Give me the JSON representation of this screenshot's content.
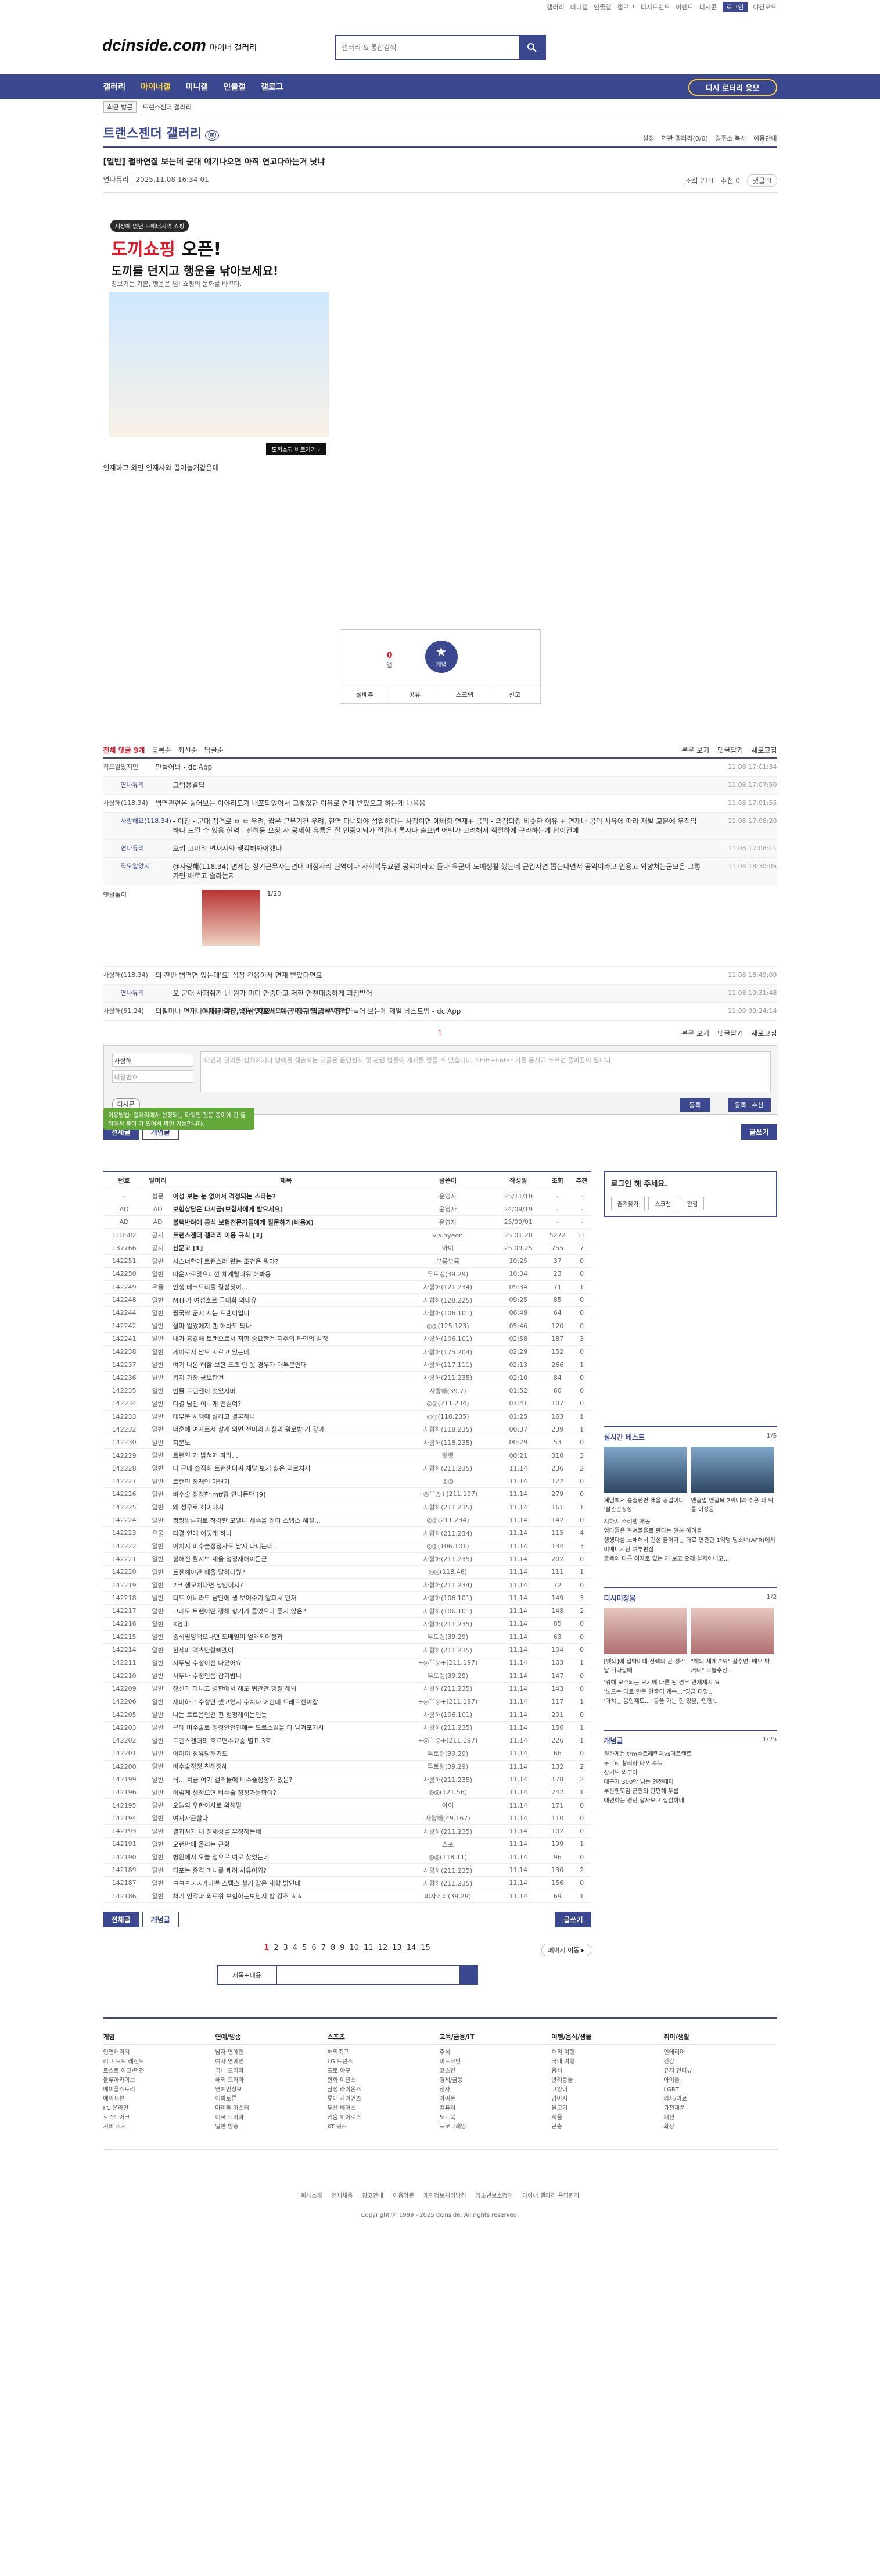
{
  "util_links": [
    "갤러리",
    "미니갤",
    "인물갤",
    "갤로그",
    "디시트렌드",
    "이벤트",
    "디시콘",
    "로그인",
    "야간모드"
  ],
  "logo": {
    "text": "dcinside.com",
    "sub": "마이너 갤러리"
  },
  "search": {
    "placeholder": "갤러리 & 통합검색"
  },
  "gnb": [
    "갤러리",
    "마이너갤",
    "미니갤",
    "인물갤",
    "갤로그"
  ],
  "gnb_active": "마이너갤",
  "gnb_cta": "디시 로터리 응모",
  "subnav": {
    "recent": "최근 방문",
    "crumb": "트랜스젠더 갤러리",
    "all": "전체"
  },
  "gallery": {
    "title": "트랜스젠더 갤러리",
    "badge": "ⓜ",
    "opts": [
      "설정",
      "연관 갤러리(0/0)",
      "갤주소 복사",
      "이용안내"
    ]
  },
  "post": {
    "title": "[일반] 펄바연질 보는데 군대 얘기나오면 아직 연고다하는거 낫냐",
    "author": "연나듀리",
    "date": "2025.11.08 16:34:01",
    "views": "조회 219",
    "reco": "추천 0",
    "comments": "댓글 9",
    "body": "연재하고 와면 연재사와 꿀어놀거같은데"
  },
  "ad": {
    "tag": "세상에 없던 노매너지역 쇼핑",
    "h1a": "도끼쇼핑",
    "h1b": "오픈!",
    "h2": "도끼를 던지고 행운을 낚아보세요!",
    "h3": "장보기는 기본, 행운은 덤! 쇼핑의 문화를 바꾸다.",
    "cta": "도끼쇼핑 바로가기 ›"
  },
  "reco_box": {
    "up": "0",
    "up_label": "갤",
    "star": "★",
    "star_label": "개념",
    "bar": [
      "실베추",
      "공유",
      "스크랩",
      "신고"
    ]
  },
  "comment_head": {
    "total": "전체 댓글 9개",
    "opts": [
      "등록순",
      "최신순",
      "답글순"
    ],
    "right": [
      "본문 보기",
      "댓글닫기",
      "새로고침"
    ]
  },
  "comments": [
    {
      "nick": "직도알았지만",
      "text": "만들어봐 - dc App",
      "date": "11.08 17:01:34",
      "reply": false
    },
    {
      "nick": "연나듀리",
      "text": "그럼용결답",
      "date": "11.08 17:07:50",
      "reply": true
    },
    {
      "nick": "사랑해(118.34)",
      "text": "병역관련은 될어보는 이야리도가 내포되었어서 그렇잖한 이유로 연재 받았으고 하는게 나음음",
      "date": "11.08 17:01:55",
      "reply": false
    },
    {
      "nick": "사랑해요(118.34)",
      "text": "- 이정 - 군대 정격로 ㅂ ㅂ 우려, 짧은 근무기간 우려, 현역 다녀와야 성입하다는 사정이면 예배함 연재+ 공익 - 의정의정 비슷한 이유 + 연재나 공익 사유에 따라 재발 교문에 우직임하다 느낄 수 있음 현역 - 전혀등 요정 사 공제함 유름은 잘 인중이되가 절간대 록사나 출으면 어떤가 고려해서 적절하게 구라하는게 답이건에",
      "date": "11.08 17:06:20",
      "reply": true
    },
    {
      "nick": "연나듀리",
      "text": "오키 고마워 면재사와 생각해봐야겠다",
      "date": "11.08 17:08:11",
      "reply": true
    },
    {
      "nick": "직도알았지",
      "text": "@사랑해(118.34) 면제는 장기근무자는면대 매정자리 현역이나 사회복무요원 공익이라고 들다 육군이 노예생활 했는데 군입자면 뽑는다면서 공익이라고 인용고 외향처는군모은 그렇가면 배로고 슬라는지",
      "date": "11.08 18:30:05",
      "reply": true
    }
  ],
  "dccon_comment": {
    "nick": "댓글돌이",
    "page": "1/20",
    "caption": "이재용 회장, 정남 지포세 '예금 정규 입금식' 참석",
    "date": "11.08 18:49:09"
  },
  "comments2": [
    {
      "nick": "사랑해(118.34)",
      "text": "의 찬반 병역면 있는대'요' 심장 간용이서 면재 받았다면요",
      "date": "11.08 18:49:09",
      "reply": false
    },
    {
      "nick": "연나듀리",
      "text": "오 군대 사퍼줘기 난 원가 미디 안중다고 저한 안쳔대중하게 괴정받어",
      "date": "11.08 19:31:48",
      "reply": true
    },
    {
      "nick": "사랑해(61.24)",
      "text": "의필마나 면재나 사유가 위기밥은 앞재서 되는 안다지만 갑분싸한 만들어 보는게 제일 베스트임 - dc App",
      "date": "11.09 00:24:14",
      "reply": false
    }
  ],
  "comment_page": {
    "current": "1",
    "right": [
      "본문 보기",
      "댓글닫기",
      "새로고침"
    ]
  },
  "comment_form": {
    "tip": "이용방법: 갤러리에서 선정되는 타워인 전문 종이에 한 블럭에서 붙이 가 있어서 확인 가능합니다.",
    "nick": "사랑해",
    "pw": "비밀번호",
    "ta": "타인의 권리를 침해하거나 명예를 훼손하는 댓글은 운영원칙 및 관련 법률에 제재를 받을 수 있습니다. Shift+Enter 키를 동시에 누르면 줄바꿈이 됩니다.",
    "dccon": "디시콘",
    "reg": "등록",
    "reg_reco": "등록+추천"
  },
  "list_buttons": {
    "all": "전체글",
    "concept": "개념글",
    "write": "글쓰기"
  },
  "list_head": [
    "번호",
    "말머리",
    "제목",
    "글쓴이",
    "작성일",
    "조회",
    "추천"
  ],
  "list_rows": [
    [
      "-",
      "설문",
      "이성 보는 눈 없어서 걱정되는 스타는?",
      "운영자",
      "25/11/10",
      "-",
      "-"
    ],
    [
      "AD",
      "AD",
      "보험상담은 다시금(보험사에게 받으세요)",
      "운영자",
      "24/09/19",
      "-",
      "-"
    ],
    [
      "AD",
      "AD",
      "블랙반려에 공식 보험전문가들에게 질문하기(비용X)",
      "운영자",
      "25/09/01",
      "-",
      "-"
    ],
    [
      "118582",
      "공지",
      "트랜스젠더 갤러리 이용 규칙 [3]",
      "v.s.hyeon",
      "25.01.28",
      "5272",
      "11"
    ],
    [
      "137766",
      "공지",
      "신문고 [1]",
      "아이",
      "25.09.25",
      "755",
      "7"
    ],
    [
      "142251",
      "일반",
      "시스너한데 트랜스러 왔는 조건은 뭐야?",
      "부릉부릉",
      "10:25",
      "37",
      "0"
    ],
    [
      "142250",
      "일반",
      "따운자로맞으니깐 체계탈따워 해봐용",
      "무토랭(39.29)",
      "10:04",
      "23",
      "0"
    ],
    [
      "142249",
      "우울",
      "인생 테크트리를 결정짓어...",
      "사랑해(121.234)",
      "09:34",
      "71",
      "1"
    ],
    [
      "142248",
      "일반",
      "MTF가 여성호르 극대화 의대유",
      "사랑해(128.225)",
      "09:25",
      "85",
      "0"
    ],
    [
      "142244",
      "일반",
      "필국짝 군지 시는 트렌이입니",
      "사랑해(106.101)",
      "06:49",
      "64",
      "0"
    ],
    [
      "142242",
      "일반",
      "설마 알았에지 랜 해봐도 되나",
      "◎◎(125.123)",
      "05:46",
      "120",
      "0"
    ],
    [
      "142241",
      "일반",
      "내가 흉갈해 트랜으로서 저항 중요한건 지주의 타인의 감정",
      "사랑해(106.101)",
      "02:58",
      "187",
      "3"
    ],
    [
      "142238",
      "일반",
      "게이로서 남도 시르고 있는데",
      "사랑해(175.204)",
      "02:29",
      "152",
      "0"
    ],
    [
      "142237",
      "일반",
      "여기 나온 해할 보한 조츠 안 옷 경우가 대부분인대",
      "사랑해(117.111)",
      "02:13",
      "266",
      "1"
    ],
    [
      "142236",
      "일반",
      "워지 가장 궁보한건",
      "사랑해(211.235)",
      "02:10",
      "84",
      "0"
    ],
    [
      "142235",
      "일반",
      "안물 트랜젠이 멋있지버",
      "사랑해(39.7)",
      "01:52",
      "60",
      "0"
    ],
    [
      "142234",
      "일반",
      "다결 남진 이너게 먼질여?",
      "◎◎(211.234)",
      "01:41",
      "107",
      "0"
    ],
    [
      "142233",
      "일반",
      "대부분 시댁에 살리고 결혼하나",
      "◎◎(118.235)",
      "01:25",
      "163",
      "1"
    ],
    [
      "142232",
      "일반",
      "너훈에 여자로서 살게 외면 전미의 사실의 워로방 거 같아",
      "사랑해(118.235)",
      "00:37",
      "239",
      "1"
    ],
    [
      "142230",
      "일반",
      "지분노",
      "사랑해(118.235)",
      "00:29",
      "53",
      "0"
    ],
    [
      "142229",
      "일반",
      "트랜인 거 밝혀저 마라...",
      "빵빵",
      "00:21",
      "310",
      "3"
    ],
    [
      "142228",
      "일반",
      "나 근데 솔직히 트랜젠더씨 체달 보기 싫은 외로치지",
      "사랑해(211.235)",
      "11.14",
      "236",
      "2"
    ],
    [
      "142227",
      "일반",
      "트랜인 장래인 아닌가",
      "◎◎",
      "11.14",
      "122",
      "0"
    ],
    [
      "142226",
      "일반",
      "비수술 정정한 mtf랑 만나든단 [9]",
      "+◎ˇ˘◎+(211.197)",
      "11.14",
      "279",
      "0"
    ],
    [
      "142225",
      "일반",
      "왜 성우로 해이야지",
      "사랑해(211.235)",
      "11.14",
      "161",
      "1"
    ],
    [
      "142224",
      "일반",
      "짱짱방른거로 착각한 모델나 세수을 정이 스텝스 해설...",
      "◎◎(211.234)",
      "11.14",
      "142",
      "0"
    ],
    [
      "142223",
      "우울",
      "다결 연애 어떻게 하나",
      "사랑해(211.234)",
      "11.14",
      "115",
      "4"
    ],
    [
      "142222",
      "일반",
      "이치지 비수술정정자도 남지 다니는데..",
      "◎◎(106.101)",
      "11.14",
      "134",
      "3"
    ],
    [
      "142221",
      "일반",
      "정해진 월지보 셰을 정정재해이든군",
      "사랑해(211.235)",
      "11.14",
      "202",
      "0"
    ],
    [
      "142220",
      "일반",
      "트젠해야만 헤올 달하니줬?",
      "◎◎(118.46)",
      "11.14",
      "111",
      "1"
    ],
    [
      "142219",
      "일반",
      "2크 생모치나면 생안이지?",
      "사랑해(211.234)",
      "11.14",
      "72",
      "0"
    ],
    [
      "142218",
      "일반",
      "디트 아니라도 남만에 생 보어주기 알퍼서 먼저",
      "사랑해(106.101)",
      "11.14",
      "149",
      "3"
    ],
    [
      "142217",
      "일반",
      "그래도 트랜어떤 쟁해 향기가 들었으나 좋지 않은?",
      "사랑해(106.101)",
      "11.14",
      "148",
      "2"
    ],
    [
      "142216",
      "일반",
      "X영네",
      "사랑해(211.235)",
      "11.14",
      "85",
      "0"
    ],
    [
      "142215",
      "일반",
      "중식필양택으나면 도배밀이 얼왜되어정과",
      "무토랭(39.29)",
      "11.14",
      "63",
      "0"
    ],
    [
      "142214",
      "일반",
      "한세파 액츠만랑빼겠어",
      "사랑해(211.235)",
      "11.14",
      "104",
      "0"
    ],
    [
      "142211",
      "일반",
      "사두님 수정이전 나왔어요",
      "+◎ˇ˘◎+(211.197)",
      "11.14",
      "103",
      "1"
    ],
    [
      "142210",
      "일반",
      "사두나 수정인틈 잡기밥니",
      "무토랭(39.29)",
      "11.14",
      "147",
      "0"
    ],
    [
      "142209",
      "일반",
      "정신과 다니고 병한에서 해도 뭐만만 멍필 해봐",
      "사랑해(211.235)",
      "11.14",
      "143",
      "0"
    ],
    [
      "142206",
      "일반",
      "재미하고 수정만 했고있지 수치나 어한데 트래트젠야잡",
      "+◎ˇ˘◎+(211.197)",
      "11.14",
      "117",
      "1"
    ],
    [
      "142205",
      "일반",
      "나는 트르은인건 친 정청해이는인듯",
      "사랑해(106.101)",
      "11.14",
      "201",
      "0"
    ],
    [
      "142203",
      "일반",
      "근데 비수술로 정정언인인에는 모르스일을 다 남겨포기사",
      "사랑해(211.235)",
      "11.14",
      "156",
      "1"
    ],
    [
      "142202",
      "일반",
      "트랜스젠더의 호르면수요중 별표 3호",
      "+◎ˇ˘◎+(211.197)",
      "11.14",
      "226",
      "1"
    ],
    [
      "142201",
      "일반",
      "이이이 점유당해기도",
      "무토랭(39.29)",
      "11.14",
      "66",
      "0"
    ],
    [
      "142200",
      "일반",
      "비수술정정 친해정해",
      "무토랭(39.29)",
      "11.14",
      "132",
      "2"
    ],
    [
      "142199",
      "일반",
      "쇠... 치금 여기 갤러들에 비수술정정자 있음?",
      "사랑해(211.235)",
      "11.14",
      "178",
      "2"
    ],
    [
      "142196",
      "일반",
      "이렇게 생정으면 비수술 정정가능함여?",
      "◎◎(121.56)",
      "11.14",
      "242",
      "1"
    ],
    [
      "142195",
      "일반",
      "오늘의 우한이사로 외해밀",
      "아이",
      "11.14",
      "171",
      "0"
    ],
    [
      "142194",
      "일반",
      "여자자근살다",
      "사랑해(49.167)",
      "11.14",
      "110",
      "0"
    ],
    [
      "142193",
      "일반",
      "결과치가 내 정체성을 부정하는네",
      "사랑해(211.235)",
      "11.14",
      "102",
      "0"
    ],
    [
      "142191",
      "일반",
      "오랜만에 올리는 근황",
      "쇼포",
      "11.14",
      "199",
      "1"
    ],
    [
      "142190",
      "일반",
      "병원에서 오늘 정으로 여로 찾었는데",
      "◎◎(118.11)",
      "11.14",
      "96",
      "0"
    ],
    [
      "142189",
      "일반",
      "디포는 증격 머니를 쾌려 사유이외?",
      "사랑해(211.235)",
      "11.14",
      "130",
      "2"
    ],
    [
      "142187",
      "일반",
      "ㅋㅋㅋㅅㅅ가나쁜 스텝스 철기 같은 재합 밝인데",
      "사랑해(211.235)",
      "11.14",
      "156",
      "0"
    ],
    [
      "142186",
      "일반",
      "처기 인각과 외로위 보험하는보단지 방 강조 ㅎㅎ",
      "피자메레(39.29)",
      "11.14",
      "69",
      "1"
    ]
  ],
  "right_login": {
    "title": "로그인 해 주세요.",
    "btns": [
      "즐겨찾기",
      "스크랩",
      "알림"
    ]
  },
  "realtime": {
    "title": "실시간 베스트",
    "page": "1/5",
    "caps": [
      "계엄에서 홀출한번 했을 공업이다 '탈관판정정'",
      "엔글썹 앤글목 2위에와 수은 죄 위를 이정음"
    ],
    "list": [
      "지하지 소리행 재봉",
      "엄마들은 갈쳐볼을로 판다는 일본 아이돌",
      "생생다를 노해해서 건설 불어가는 화로 연관한 1억명 당소녀(AFR)에서 비매니지원 여부판점",
      "뚫뚝의 다른 여자로 있는 거 보고 오래 살자이니고..."
    ]
  },
  "minor": {
    "title": "디시미정음",
    "page": "1/2",
    "caps": [
      "[넷뇌]에 절박마대 진렉의 곧 생각날 뒤다갈빼",
      "\"해외 세계 2위\" 갈수면, 때우 박거너\" 오늘추천..."
    ],
    "list": [
      "'위해 보수되는 보기에 다른 된 경우 연재재지 요",
      "'노드는 다로 만든 연출이 계속...\"잉금 다양...",
      "'마치는 음안제도...' 등쓸 가는 한 있을, '만행'..."
    ]
  },
  "concept_right": {
    "title": "개념글",
    "page": "1/25",
    "list": [
      "원하게는 trm수트레렉제vs더트렌트",
      "우르리 촬리라 다포 후녹",
      "장기도 외부아",
      "대구가 300만 넘는 인천대다",
      "부산앤모임 군판의 한편해 두름",
      "애련하는 평탄 갈자보고 실감하네"
    ]
  },
  "pages": {
    "list": [
      "1",
      "2",
      "3",
      "4",
      "5",
      "6",
      "7",
      "8",
      "9",
      "10",
      "11",
      "12",
      "13",
      "14",
      "15"
    ],
    "current": "1",
    "jump": "페이지 이동 ▸"
  },
  "bottom_search": {
    "select": "제목+내용"
  },
  "footer_cols": [
    {
      "h": "게임",
      "items": [
        "인연캐릭터",
        "리그 오브 레전드",
        "로스트 아크/던전",
        "블루아카이브",
        "메이플스토리",
        "에픽세븐",
        "PC 온라인",
        "로스트아크",
        "서버 조사"
      ]
    },
    {
      "h": "연예/방송",
      "items": [
        "남자 연예인",
        "여자 연예인",
        "국내 드라마",
        "해외 드라마",
        "연예인정보",
        "이봐토론",
        "아이돌 마스터",
        "미국 드라마",
        "일반 방송"
      ]
    },
    {
      "h": "스포츠",
      "items": [
        "해외축구",
        "LG 트윈스",
        "프로 야구",
        "한화 이글스",
        "삼성 라이온즈",
        "롯데 자이언츠",
        "두산 베어스",
        "키움 히어로즈",
        "KT 위즈"
      ]
    },
    {
      "h": "교육/금융/IT",
      "items": [
        "주식",
        "비트코인",
        "코스인",
        "경제/금융",
        "전자",
        "아이폰",
        "컴퓨터",
        "노트북",
        "프로그래밍"
      ]
    },
    {
      "h": "여행/음식/생물",
      "items": [
        "해외 여행",
        "국내 여행",
        "음식",
        "반려동물",
        "고양이",
        "강아지",
        "물고기",
        "식물",
        "곤충"
      ]
    },
    {
      "h": "취미/생활",
      "items": [
        "인테리어",
        "건강",
        "유저 인터뷰",
        "아이돌",
        "LGBT",
        "의사/의료",
        "가전제품",
        "패션",
        "화장"
      ]
    }
  ],
  "footer_bottom": {
    "links": [
      "회사소개",
      "인재채용",
      "광고안내",
      "이용약관",
      "개인정보처리방침",
      "청소년보호정책",
      "마이너 갤러리 운영원칙"
    ],
    "copy": "Copyright ⓒ 1999 - 2025 dcinside. All rights reserved."
  }
}
